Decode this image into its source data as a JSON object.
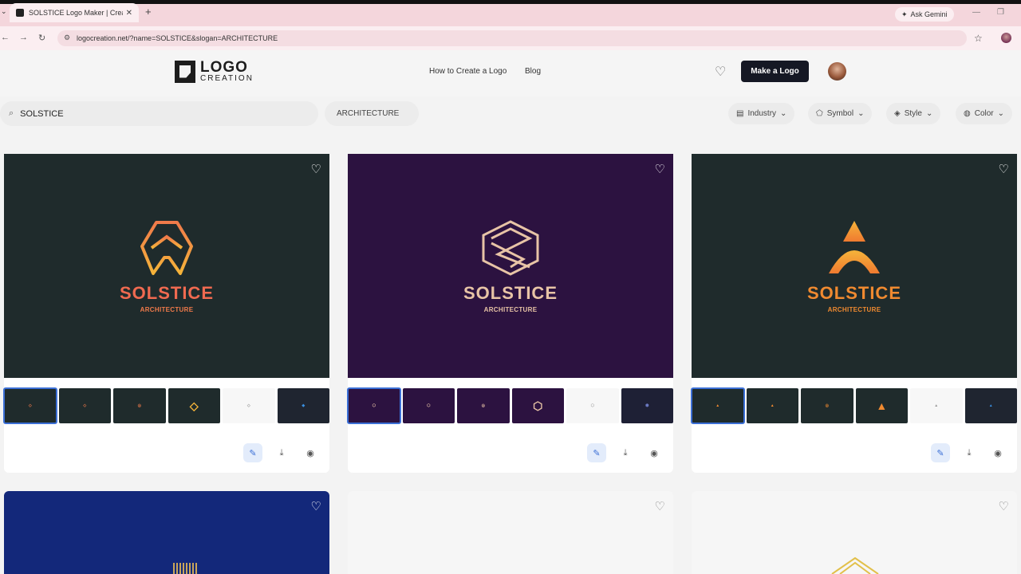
{
  "browser": {
    "tab_title": "SOLSTICE Logo Maker | Create",
    "url": "logocreation.net/?name=SOLSTICE&slogan=ARCHITECTURE",
    "gemini_label": "Ask Gemini"
  },
  "header": {
    "logo_line1": "LOGO",
    "logo_line2": "CREATION",
    "nav": [
      "How to Create a Logo",
      "Blog"
    ],
    "cta": "Make a Logo"
  },
  "search": {
    "name": "SOLSTICE",
    "slogan": "ARCHITECTURE",
    "filters": [
      "Industry",
      "Symbol",
      "Style",
      "Color"
    ]
  },
  "cards": [
    {
      "name": "SOLSTICE",
      "slogan": "ARCHITECTURE",
      "bg": "#1f2b2c",
      "accent": "#f07a4a"
    },
    {
      "name": "SOLSTICE",
      "slogan": "ARCHITECTURE",
      "bg": "#2c1240",
      "accent": "#e8c4a6"
    },
    {
      "name": "SOLSTICE",
      "slogan": "ARCHITECTURE",
      "bg": "#1f2b2c",
      "accent": "#f08a30"
    }
  ],
  "colors": {
    "cta_bg": "#151824",
    "selected": "#3b6fd6"
  }
}
